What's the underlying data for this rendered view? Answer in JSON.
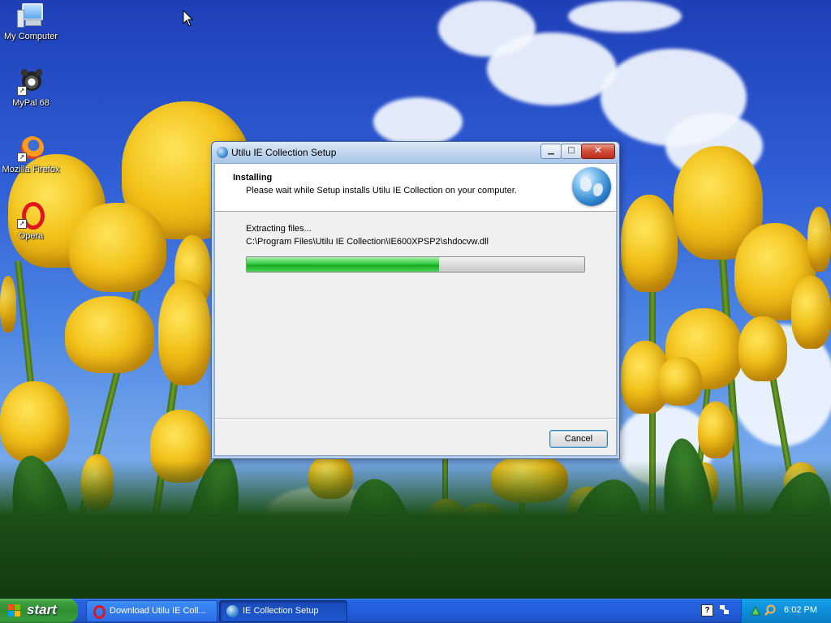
{
  "desktop": {
    "icons": [
      {
        "label": "My Computer",
        "icon": "my-computer-icon"
      },
      {
        "label": "MyPal 68",
        "icon": "mypal-icon"
      },
      {
        "label": "Mozilla Firefox",
        "icon": "firefox-icon"
      },
      {
        "label": "Opera",
        "icon": "opera-icon"
      }
    ]
  },
  "dialog": {
    "title": "Utilu IE Collection Setup",
    "header_title": "Installing",
    "header_subtitle": "Please wait while Setup installs Utilu IE Collection on your computer.",
    "status": "Extracting files...",
    "current_file": "C:\\Program Files\\Utilu IE Collection\\IE600XPSP2\\shdocvw.dll",
    "progress_fraction": 0.57,
    "cancel_label": "Cancel",
    "window_buttons": {
      "minimize": "minimize-icon",
      "maximize": "maximize-icon",
      "close": "close-icon"
    }
  },
  "taskbar": {
    "start_label": "start",
    "tasks": [
      {
        "label": "Download Utilu IE Coll...",
        "icon": "opera-icon"
      },
      {
        "label": "IE Collection Setup",
        "icon": "globe-icon"
      }
    ],
    "clock": "6:02 PM"
  },
  "colors": {
    "taskbar_blue": "#245edb",
    "start_green": "#3c9f3c",
    "progress_green": "#18a823",
    "tray_blue": "#0e8ed8"
  }
}
